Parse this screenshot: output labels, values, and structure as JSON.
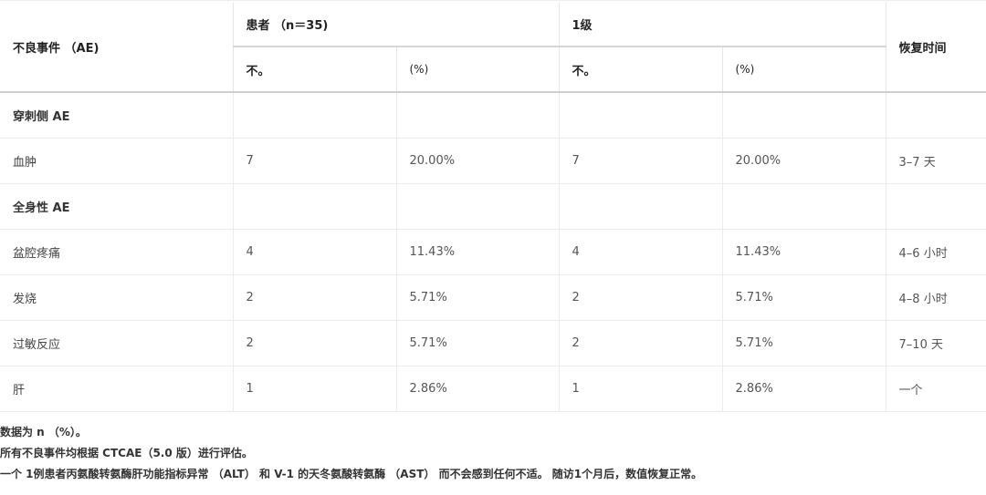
{
  "table": {
    "header": {
      "event": "不良事件 （AE)",
      "patients": "患者 （n＝35)",
      "grade": "1级",
      "recovery": "恢复时间",
      "no1": "不。",
      "pct1": "(%)",
      "no2": "不。",
      "pct2": "(%)"
    },
    "rows": [
      {
        "type": "section",
        "label": "穿刺侧 AE"
      },
      {
        "type": "data",
        "label": "血肿",
        "n": "7",
        "pct": "20.00%",
        "g_n": "7",
        "g_pct": "20.00%",
        "recovery": "3–7 天"
      },
      {
        "type": "section",
        "label": "全身性 AE"
      },
      {
        "type": "data",
        "label": "盆腔疼痛",
        "n": "4",
        "pct": "11.43%",
        "g_n": "4",
        "g_pct": "11.43%",
        "recovery": "4–6 小时"
      },
      {
        "type": "data",
        "label": "发烧",
        "n": "2",
        "pct": "5.71%",
        "g_n": "2",
        "g_pct": "5.71%",
        "recovery": "4–8 小时"
      },
      {
        "type": "data",
        "label": "过敏反应",
        "n": "2",
        "pct": "5.71%",
        "g_n": "2",
        "g_pct": "5.71%",
        "recovery": "7–10 天"
      },
      {
        "type": "data",
        "label": "肝",
        "n": "1",
        "pct": "2.86%",
        "g_n": "1",
        "g_pct": "2.86%",
        "recovery": "一个"
      }
    ]
  },
  "notes": [
    "数据为 n （%）。",
    "所有不良事件均根据 CTCAE（5.0 版）进行评估。",
    "一个 1例患者丙氨酸转氨酶肝功能指标异常 （ALT） 和 V-1 的天冬氨酸转氨酶 （AST） 而不会感到任何不适。 随访1个月后，数值恢复正常。"
  ]
}
